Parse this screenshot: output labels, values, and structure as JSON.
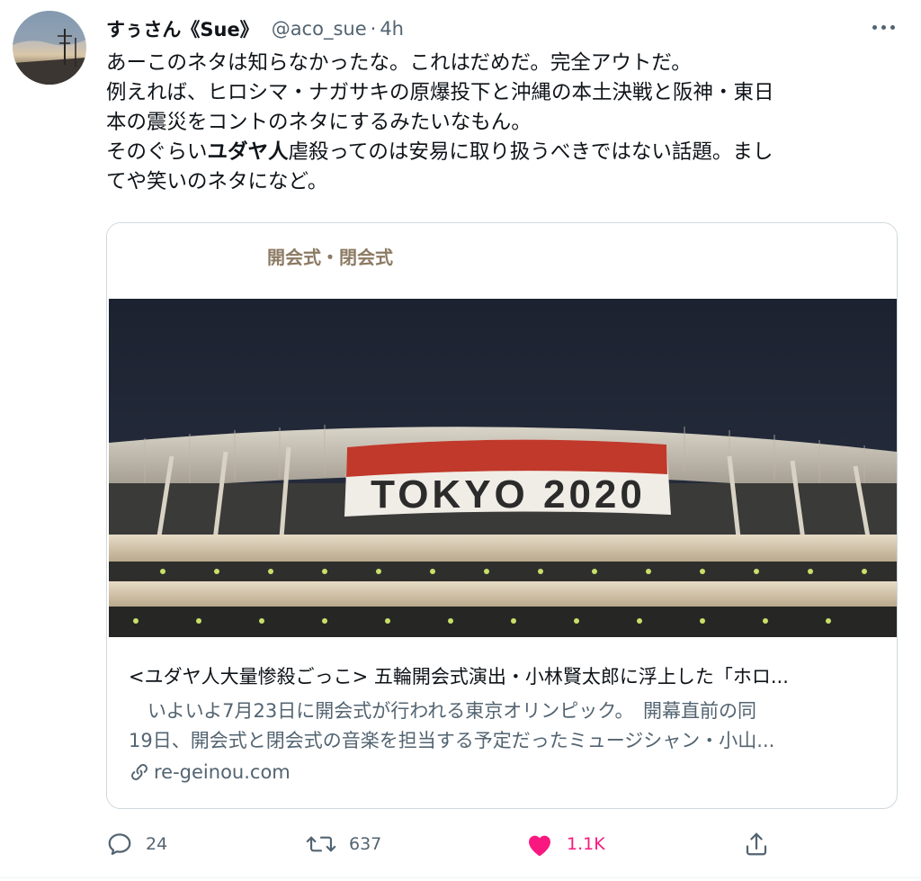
{
  "tweet": {
    "display_name": "すぅさん《Sue》",
    "handle": "@aco_sue",
    "separator": "·",
    "time": "4h",
    "text_lines": [
      "あーこのネタは知らなかったな。これはだめだ。完全アウトだ。",
      "例えれば、ヒロシマ・ナガサキの原爆投下と沖縄の本土決戦と阪神・東日",
      "本の震災をコントのネタにするみたいなもん。"
    ],
    "line4_before": "そのぐらい",
    "line4_bold": "ユダヤ人",
    "line4_after": "虐殺ってのは安易に取り扱うべきではない話題。まし",
    "line5": "てや笑いのネタになど。"
  },
  "card": {
    "category": "開会式・閉会式",
    "banner_text": "TOKYO 2020",
    "title": "<ユダヤ人大量惨殺ごっこ> 五輪開会式演出・小林賢太郎に浮上した「ホロ...",
    "desc_lines": [
      "　いよいよ7月23日に開会式が行われる東京オリンピック。　開幕直前の同",
      "19日、開会式と閉会式の音楽を担当する予定だったミュージシャン・小山..."
    ],
    "domain": "re-geinou.com"
  },
  "actions": {
    "replies": "24",
    "retweets": "637",
    "likes": "1.1K"
  },
  "colors": {
    "text": "#0f1419",
    "secondary": "#536471",
    "like": "#f91880",
    "border": "#cfd9de"
  },
  "icons": [
    "more-icon",
    "link-icon",
    "reply-icon",
    "retweet-icon",
    "like-icon",
    "share-icon"
  ]
}
